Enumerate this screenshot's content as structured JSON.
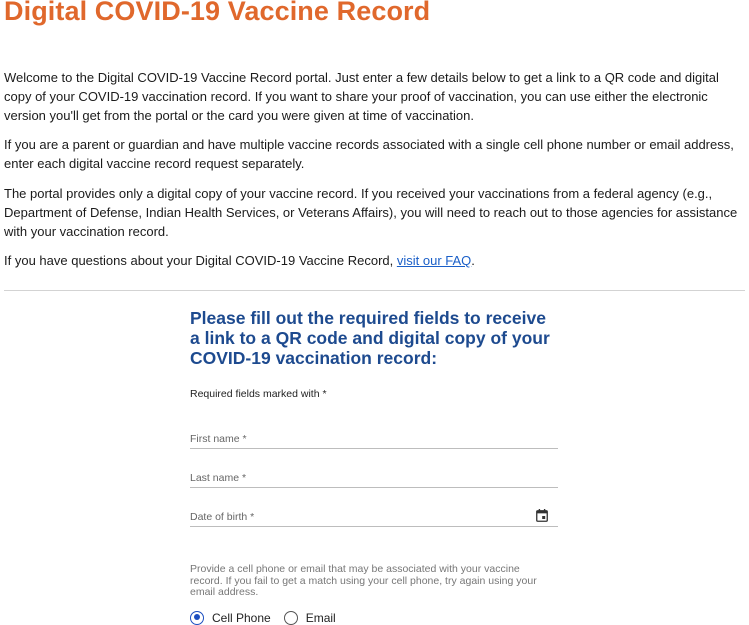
{
  "page": {
    "title": "Digital COVID-19 Vaccine Record",
    "intro": {
      "p1": "Welcome to the Digital COVID-19 Vaccine Record portal. Just enter a few details below to get a link to a QR code and digital copy of your COVID-19 vaccination record. If you want to share your proof of vaccination, you can use either the electronic version you'll get from the portal or the card you were given at time of vaccination.",
      "p2": "If you are a parent or guardian and have multiple vaccine records associated with a single cell phone number or email address, enter each digital vaccine record request separately.",
      "p3": "The portal provides only a digital copy of your vaccine record. If you received your vaccinations from a federal agency (e.g., Department of Defense, Indian Health Services, or Veterans Affairs), you will need to reach out to those agencies for assistance with your vaccination record.",
      "p4_prefix": "If you have questions about your Digital COVID-19 Vaccine Record, ",
      "p4_link": "visit our FAQ",
      "p4_suffix": "."
    }
  },
  "form": {
    "heading": "Please fill out the required fields to receive a link to a QR code and digital copy of your COVID-19 vaccination record:",
    "required_note": "Required fields marked with *",
    "fields": {
      "first_name": {
        "label": "First name *",
        "value": ""
      },
      "last_name": {
        "label": "Last name *",
        "value": ""
      },
      "dob": {
        "label": "Date of birth *",
        "value": "",
        "icon": "calendar-icon"
      }
    },
    "contact_helper": "Provide a cell phone or email that may be associated with your vaccine record. If you fail to get a match using your cell phone, try again using your email address.",
    "contact_options": [
      {
        "label": "Cell Phone",
        "selected": true
      },
      {
        "label": "Email",
        "selected": false
      }
    ]
  },
  "colors": {
    "title": "#e0682c",
    "heading": "#1d4a8f",
    "link": "#1a5fc8",
    "radio_selected": "#1d4fc0"
  }
}
